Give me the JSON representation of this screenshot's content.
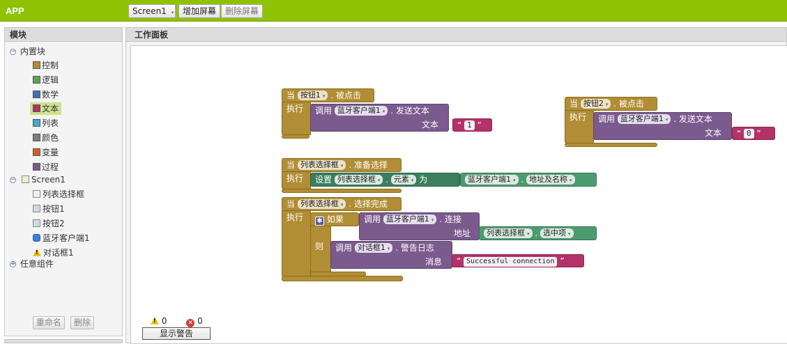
{
  "app": {
    "title": "APP"
  },
  "toolbar": {
    "screen_select": "Screen1",
    "add_screen": "增加屏幕",
    "remove_screen": "删除屏幕"
  },
  "blocks_panel": {
    "header": "模块",
    "builtin": {
      "label": "内置块",
      "items": [
        {
          "label": "控制",
          "color": "#b18e35"
        },
        {
          "label": "逻辑",
          "color": "#5ba55b"
        },
        {
          "label": "数学",
          "color": "#3f71b5"
        },
        {
          "label": "文本",
          "color": "#b3326a"
        },
        {
          "label": "列表",
          "color": "#49a6d4"
        },
        {
          "label": "颜色",
          "color": "#7d7d7d"
        },
        {
          "label": "变量",
          "color": "#d05f2d"
        },
        {
          "label": "过程",
          "color": "#7b5a8d"
        }
      ]
    },
    "screen": {
      "label": "Screen1",
      "components": [
        "列表选择框",
        "按钮1",
        "按钮2",
        "蓝牙客户端1",
        "对话框1"
      ]
    },
    "any_component": "任意组件",
    "rename_button": "重命名",
    "delete_button": "删除"
  },
  "workspace": {
    "header": "工作面板",
    "warnings_count": "0",
    "errors_count": "0",
    "show_warnings": "显示警告"
  },
  "blocks": {
    "b1": {
      "when": "当",
      "component": "按钮1",
      "event": ". 被点击",
      "do": "执行",
      "call": "调用",
      "target": "蓝牙客户端1",
      "method": ". 发送文本",
      "param": "文本",
      "value": "1"
    },
    "b2": {
      "when": "当",
      "component": "按钮2",
      "event": ". 被点击",
      "do": "执行",
      "call": "调用",
      "target": "蓝牙客户端1",
      "method": ". 发送文本",
      "param": "文本",
      "value": "0"
    },
    "b3": {
      "when": "当",
      "component": "列表选择框",
      "event": ". 准备选择",
      "do": "执行",
      "set": "设置",
      "target": "列表选择框",
      "prop": "元素",
      "to": "为",
      "src": "蓝牙客户端1",
      "src_prop": "地址及名称"
    },
    "b4": {
      "when": "当",
      "component": "列表选择框",
      "event": ". 选择完成",
      "do": "执行",
      "if": "如果",
      "call": "调用",
      "target": "蓝牙客户端1",
      "method": ". 连接",
      "param": "地址",
      "src": "列表选择框",
      "src_prop": "选中项",
      "then": "则",
      "call2": "调用",
      "target2": "对话框1",
      "method2": ". 警告日志",
      "param2": "消息",
      "message": "Successful  connection"
    }
  },
  "glyphs": {
    "open_quote": "“",
    "close_quote": "”",
    "dropdown_arrow": "▾",
    "dot": "."
  }
}
